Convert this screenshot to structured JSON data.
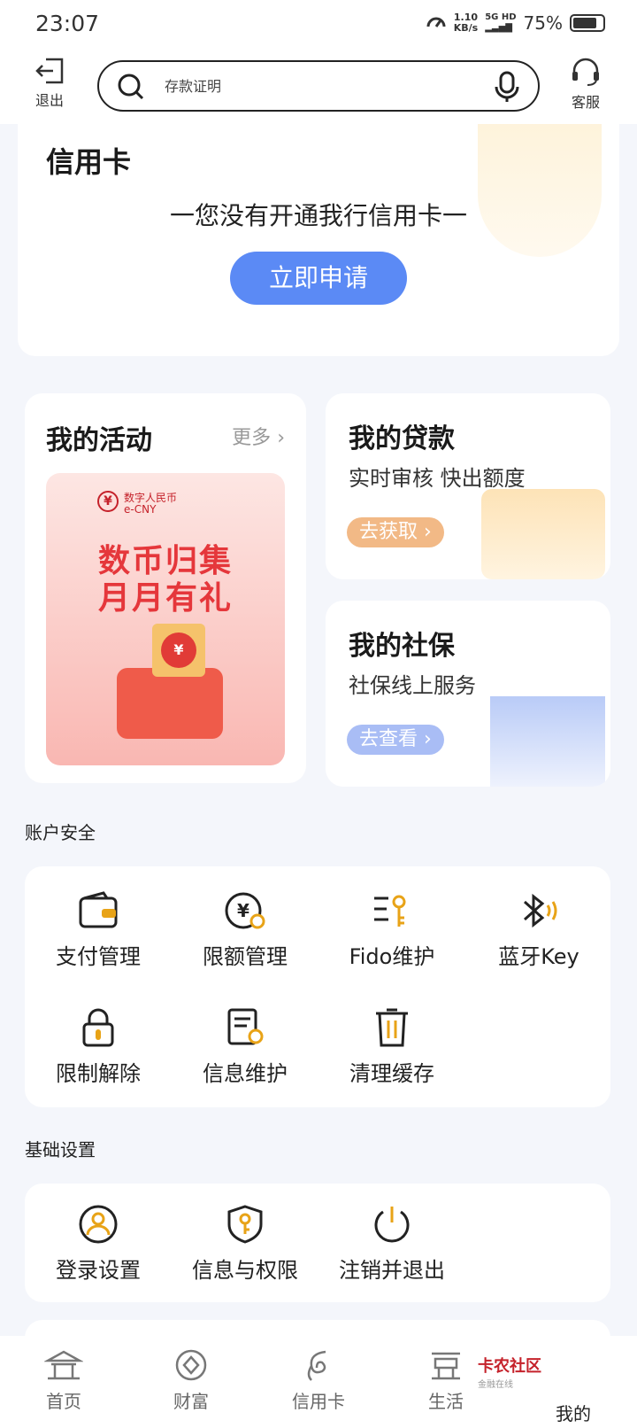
{
  "status_bar": {
    "time": "23:07",
    "net_speed": "1.10",
    "net_unit": "KB/s",
    "net_type": "5G HD",
    "battery": "75%"
  },
  "header": {
    "exit_label": "退出",
    "search_placeholder": "存款证明",
    "service_label": "客服"
  },
  "credit_card": {
    "title": "信用卡",
    "message": "一您没有开通我行信用卡一",
    "apply_label": "立即申请"
  },
  "activity": {
    "title": "我的活动",
    "more": "更多",
    "banner": {
      "brand": "数字人民币",
      "brand_en": "e-CNY",
      "line1": "数币归集",
      "line2": "月月有礼"
    }
  },
  "loan": {
    "title": "我的贷款",
    "subtitle": "实时审核 快出额度",
    "button": "去获取"
  },
  "social_security": {
    "title": "我的社保",
    "subtitle": "社保线上服务",
    "button": "去查看"
  },
  "account_security": {
    "label": "账户安全",
    "items": [
      "支付管理",
      "限额管理",
      "Fido维护",
      "蓝牙Key",
      "限制解除",
      "信息维护",
      "清理缓存"
    ]
  },
  "basic_settings": {
    "label": "基础设置",
    "items": [
      "登录设置",
      "信息与权限",
      "注销并退出"
    ]
  },
  "bottom_nav": {
    "items": [
      "首页",
      "财富",
      "信用卡",
      "生活",
      "我的"
    ],
    "watermark": "卡农社区",
    "watermark_sub": "金融在线"
  },
  "colors": {
    "accent_blue": "#5b8af5",
    "icon_gold": "#e8a317",
    "brand_red": "#e5373b"
  }
}
